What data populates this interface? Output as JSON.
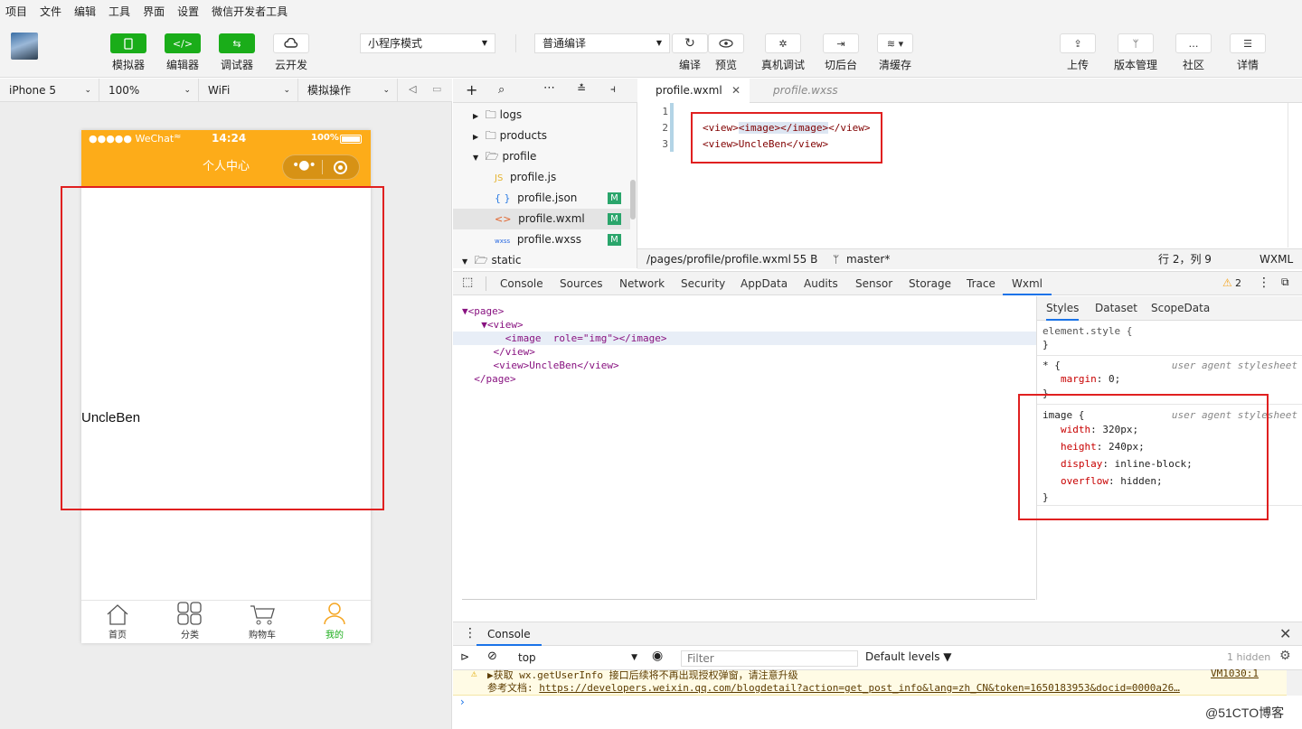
{
  "menubar": [
    "项目",
    "文件",
    "编辑",
    "工具",
    "界面",
    "设置",
    "微信开发者工具"
  ],
  "toolbar": {
    "simulator": "模拟器",
    "editor": "编辑器",
    "debugger": "调试器",
    "cloud": "云开发",
    "mode_select": "小程序模式",
    "compile_select": "普通编译",
    "compile": "编译",
    "preview": "预览",
    "real_debug": "真机调试",
    "background": "切后台",
    "clear_cache": "清缓存",
    "upload": "上传",
    "version": "版本管理",
    "community": "社区",
    "details": "详情"
  },
  "device": {
    "model": "iPhone 5",
    "zoom": "100%",
    "network": "WiFi",
    "operation": "模拟操作"
  },
  "phone": {
    "carrier": "●●●●● WeChat",
    "time": "14:24",
    "battery": "100%",
    "nav_title": "个人中心",
    "content_text": "UncleBen",
    "tabs": [
      {
        "label": "首页",
        "icon": "home-icon",
        "active": false
      },
      {
        "label": "分类",
        "icon": "grid-icon",
        "active": false
      },
      {
        "label": "购物车",
        "icon": "cart-icon",
        "active": false
      },
      {
        "label": "我的",
        "icon": "user-icon",
        "active": true
      }
    ],
    "active_color": "#1aad19",
    "nav_color": "#fdac19"
  },
  "filetree": {
    "items": [
      {
        "name": "logs",
        "type": "folder"
      },
      {
        "name": "products",
        "type": "folder"
      },
      {
        "name": "profile",
        "type": "folder-open"
      },
      {
        "name": "profile.js",
        "type": "js"
      },
      {
        "name": "profile.json",
        "type": "json",
        "badge": "M"
      },
      {
        "name": "profile.wxml",
        "type": "wxml",
        "badge": "M"
      },
      {
        "name": "profile.wxss",
        "type": "wxss",
        "badge": "M"
      },
      {
        "name": "static",
        "type": "folder-open"
      }
    ]
  },
  "editor": {
    "tab_active": "profile.wxml",
    "tab_inactive": "profile.wxss",
    "lines": [
      "1",
      "2",
      "3"
    ],
    "code2_open": "<view>",
    "code2_img": "<image></image>",
    "code2_close": "</view>",
    "code3": "<view>UncleBen</view>",
    "status_path": "/pages/profile/profile.wxml",
    "status_size": "55 B",
    "status_branch": "master*",
    "status_pos": "行 2，列 9",
    "status_lang": "WXML"
  },
  "devtools": {
    "tabs": [
      "Console",
      "Sources",
      "Network",
      "Security",
      "AppData",
      "Audits",
      "Sensor",
      "Storage",
      "Trace",
      "Wxml"
    ],
    "warn_count": "2",
    "wxml_lines": [
      "▼<page>",
      "  ▼<view>",
      "      <image  role=\"img\"></image>",
      "    </view>",
      "    <view>UncleBen</view>",
      "  </page>"
    ],
    "style_tabs": [
      "Styles",
      "Dataset",
      "ScopeData"
    ],
    "element_style": "element.style {",
    "brace_close": "}",
    "star_rule": "* {",
    "margin_prop": "margin",
    "margin_val": ": 0;",
    "ua_label": "user agent stylesheet",
    "image_rule": "image {",
    "width_prop": "width",
    "width_val": ": 320px;",
    "height_prop": "height",
    "height_val": ": 240px;",
    "display_prop": "display",
    "display_val": ": inline-block;",
    "overflow_prop": "overflow",
    "overflow_val": ": hidden;"
  },
  "console": {
    "tab": "Console",
    "context": "top",
    "filter_placeholder": "Filter",
    "levels": "Default levels ▼",
    "hidden": "1 hidden",
    "warn_line1": "▶获取 wx.getUserInfo 接口后续将不再出现授权弹窗，请注意升级",
    "warn_source": "VM1030:1",
    "warn_line2_prefix": "参考文档: ",
    "warn_link": "https://developers.weixin.qq.com/blogdetail?action=get_post_info&lang=zh_CN&token=1650183953&docid=0000a26…",
    "watermark": "@51CTO博客"
  }
}
